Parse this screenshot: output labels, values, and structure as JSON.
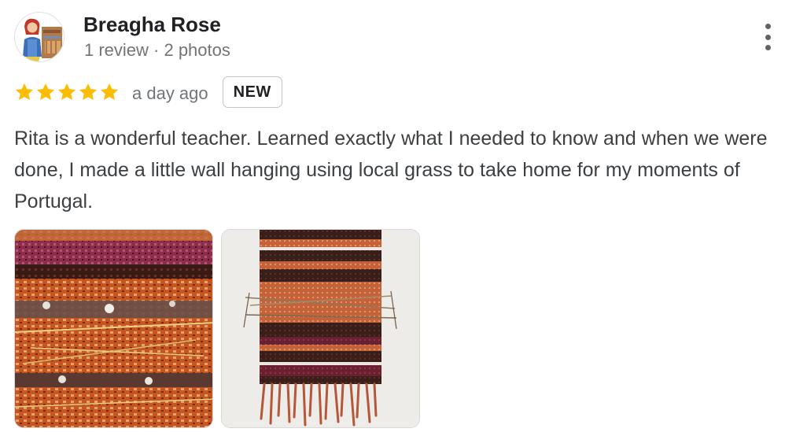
{
  "review": {
    "author_name": "Breagha Rose",
    "author_meta": "1 review · 2 photos",
    "rating": 5,
    "rating_max": 5,
    "date": "a day ago",
    "badge": "NEW",
    "text": "Rita is a wonderful teacher. Learned exactly what I needed to know and when we were done, I made a little wall hanging using local grass to take home for my moments of Portugal.",
    "photo_count": 2
  },
  "icons": {
    "menu": "more-vert-icon",
    "star": "star-icon"
  },
  "colors": {
    "star": "#fbbc04",
    "name": "#202124",
    "meta": "#70757a",
    "text": "#3c4043",
    "badge_border": "#c4c4c4"
  }
}
